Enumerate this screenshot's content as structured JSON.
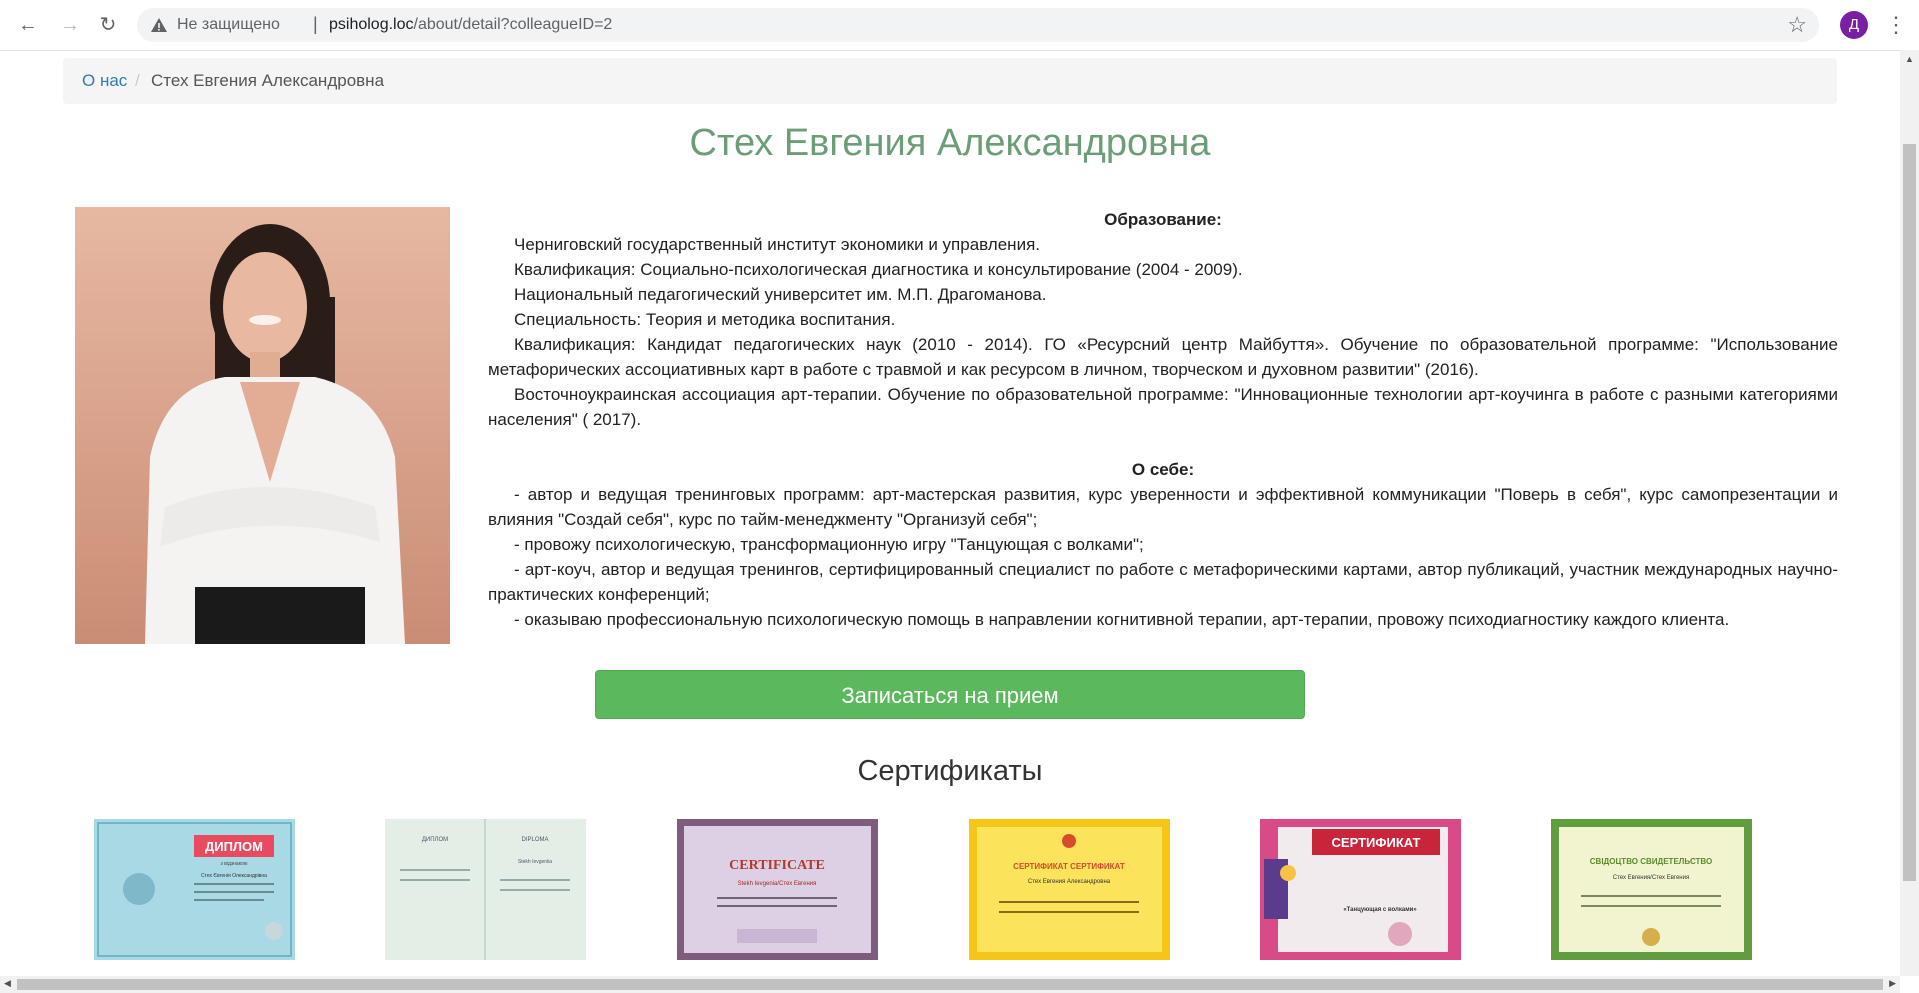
{
  "browser": {
    "security_label": "Не защищено",
    "url_host": "psiholog.loc",
    "url_path": "/about/detail?colleagueID=2",
    "profile_initial": "Д"
  },
  "breadcrumb": {
    "home_label": "О нас",
    "current_label": "Стех Евгения Александровна"
  },
  "page_title": "Стех Евгения Александровна",
  "education": {
    "heading": "Образование:",
    "lines": [
      "Черниговский государственный институт экономики и управления.",
      "Квалификация: Социально-психологическая диагностика и консультирование (2004 - 2009).",
      "Национальный педагогический университет им. М.П. Драгоманова.",
      "Специальность: Теория и методика воспитания.",
      "Квалификация: Кандидат педагогических наук (2010 - 2014). ГО «Ресурсний центр Майбуття». Обучение по образовательной программе: \"Использование метафорических ассоциативных карт в работе с травмой и как ресурсом в личном, творческом и духовном развитии\" (2016).",
      "Восточноукраинская ассоциация арт-терапии. Обучение по образовательной программе: \"Инновационные технологии арт-коучинга в работе с разными категориями населения\" ( 2017)."
    ]
  },
  "about": {
    "heading": "О себе:",
    "lines": [
      "- автор и ведущая тренинговых программ: арт-мастерская развития, курс уверенности и эффективной коммуникации \"Поверь в себя\", курс самопрезентации и влияния \"Создай себя\", курс по тайм-менеджменту \"Организуй себя\";",
      "- провожу психологическую, трансформационную игру \"Танцующая с волками\";",
      "- арт-коуч, автор и ведущая тренингов, сертифицированный специалист по работе с метафорическими картами, автор публикаций, участник международных научно-практических конференций;",
      "- оказываю профессиональную психологическую помощь в направлении когнитивной терапии, арт-терапии, провожу психодиагностику каждого клиента."
    ]
  },
  "appointment_button": "Записаться на прием",
  "certificates": {
    "heading": "Сертификаты",
    "items": [
      {
        "caption": "ДИПЛОМ",
        "sub": "з відзнакою",
        "name": "Стех Євгенія Олександрівна"
      },
      {
        "caption": "ДИПЛОМ",
        "sub": "DIPLOMA",
        "name": "Stekh Ievgeniia"
      },
      {
        "caption": "CERTIFICATE",
        "sub": "",
        "name": "Stekh Ievgenia/Стех Евгения"
      },
      {
        "caption": "СЕРТИФИКАТ СЕРТИФИКАТ",
        "sub": "",
        "name": "Стех Евгения Александровна"
      },
      {
        "caption": "СЕРТИФИКАТ",
        "sub": "«Танцующая с волками»",
        "name": ""
      },
      {
        "caption": "СВІДОЦТВО СВИДЕТЕЛЬСТВО",
        "sub": "",
        "name": "Стех Евгения/Стех Евгения"
      }
    ]
  }
}
